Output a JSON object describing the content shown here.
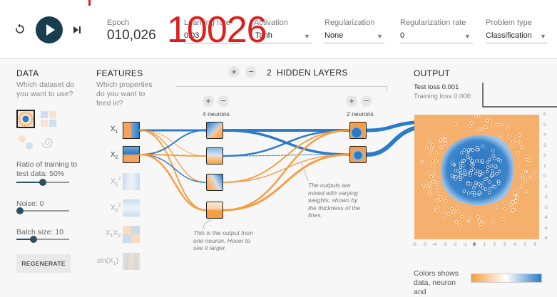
{
  "top": {
    "epoch_label": "Epoch",
    "epoch_value": "010,026",
    "overlay_number": "10026",
    "learning_rate_label": "Learning rate",
    "learning_rate_value": "0.03",
    "activation_label": "Activation",
    "activation_value": "Tanh",
    "regularization_label": "Regularization",
    "regularization_value": "None",
    "reg_rate_label": "Regularization rate",
    "reg_rate_value": "0",
    "problem_type_label": "Problem type",
    "problem_type_value": "Classification"
  },
  "data": {
    "title": "DATA",
    "subtitle": "Which dataset do you want to use?",
    "ratio_label": "Ratio of training to test data:  50%",
    "noise_label": "Noise:  0",
    "batch_label": "Batch size:  10",
    "regenerate": "REGENERATE",
    "ratio_pct": 50,
    "noise_pct": 0,
    "batch_pct": 30
  },
  "features": {
    "title": "FEATURES",
    "subtitle": "Which properties do you want to feed in?",
    "items": [
      "X1",
      "X2",
      "X1²",
      "X2²",
      "X1X2",
      "sin(X1)"
    ]
  },
  "hidden": {
    "count": "2",
    "label": "HIDDEN LAYERS",
    "layer1_neurons": "4 neurons",
    "layer2_neurons": "2 neurons",
    "note_neuron": "This is the output from one neuron. Hover to see it larger.",
    "note_weights": "The outputs are mixed with varying weights, shown by the thickness of the lines."
  },
  "output": {
    "title": "OUTPUT",
    "test_loss": "Test loss 0.001",
    "training_loss": "Training loss 0.000",
    "colors_label": "Colors shows data, neuron and",
    "x_ticks": [
      "-6",
      "-5",
      "-4",
      "-3",
      "-2",
      "-1",
      "0",
      "1",
      "2",
      "3",
      "4",
      "5",
      "6"
    ],
    "y_ticks": [
      "6",
      "5",
      "4",
      "3",
      "2",
      "1",
      "0",
      "-1",
      "-2",
      "-3",
      "-4",
      "-5",
      "-6"
    ]
  },
  "colors": {
    "orange": "#f59e44",
    "blue": "#2b7bc8",
    "dark": "#183d4e",
    "accent": "#e01e1e"
  },
  "icons": [
    "reset-icon",
    "play-icon",
    "step-icon",
    "plus-icon",
    "minus-icon"
  ]
}
